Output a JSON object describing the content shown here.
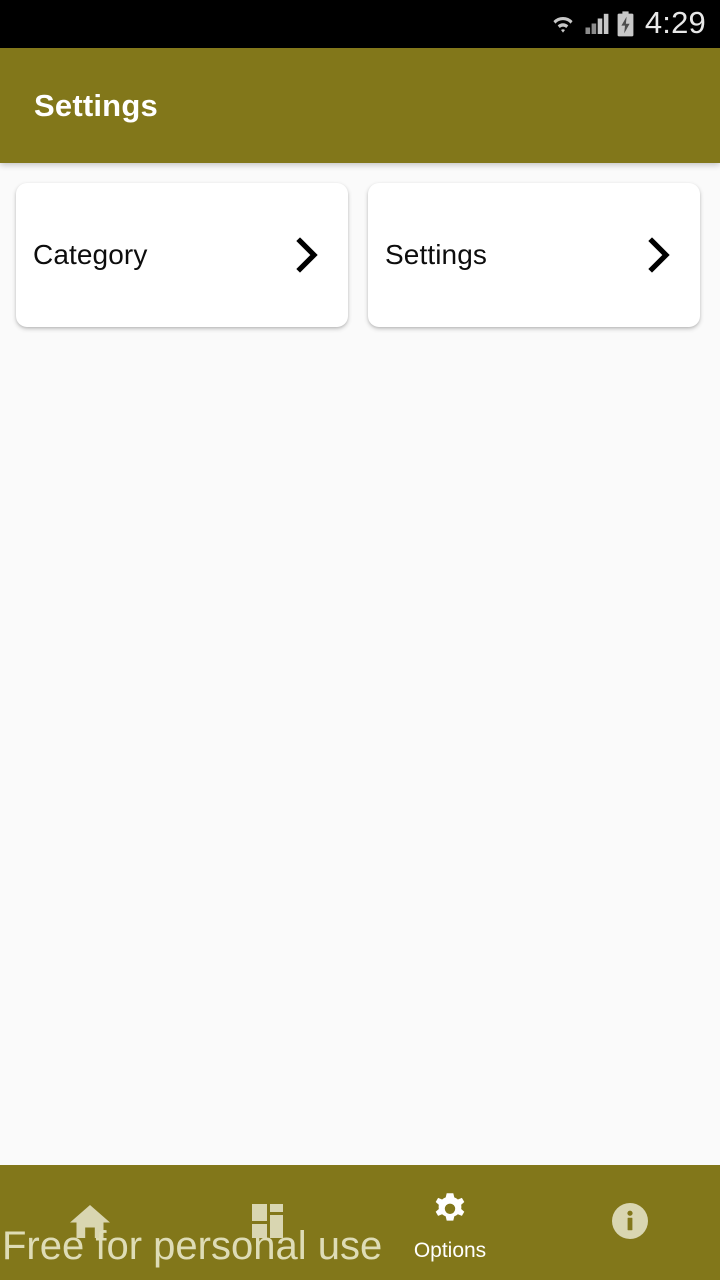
{
  "status_bar": {
    "time": "4:29",
    "icons": [
      "wifi-icon",
      "cellular-signal-icon",
      "battery-charging-icon"
    ],
    "background_color": "#000000",
    "foreground_color": "#E8E8E8"
  },
  "app_bar": {
    "title": "Settings",
    "background_color": "#82771A",
    "title_color": "#FFFFFF"
  },
  "content": {
    "background_color": "#FAFAFA",
    "cards": [
      {
        "label": "Category",
        "chevron": "chevron-right-icon"
      },
      {
        "label": "Settings",
        "chevron": "chevron-right-icon"
      }
    ]
  },
  "bottom_nav": {
    "background_color": "#82771A",
    "active_color": "#FFFFFF",
    "inactive_color": "#D9D6B1",
    "items": [
      {
        "icon": "home-icon",
        "label": "",
        "active": false
      },
      {
        "icon": "dashboard-grid-icon",
        "label": "",
        "active": false
      },
      {
        "icon": "gear-icon",
        "label": "Options",
        "active": true
      },
      {
        "icon": "info-circle-icon",
        "label": "",
        "active": false
      }
    ]
  },
  "watermark": {
    "text": "Free for personal use",
    "color": "#DEDCB6"
  }
}
